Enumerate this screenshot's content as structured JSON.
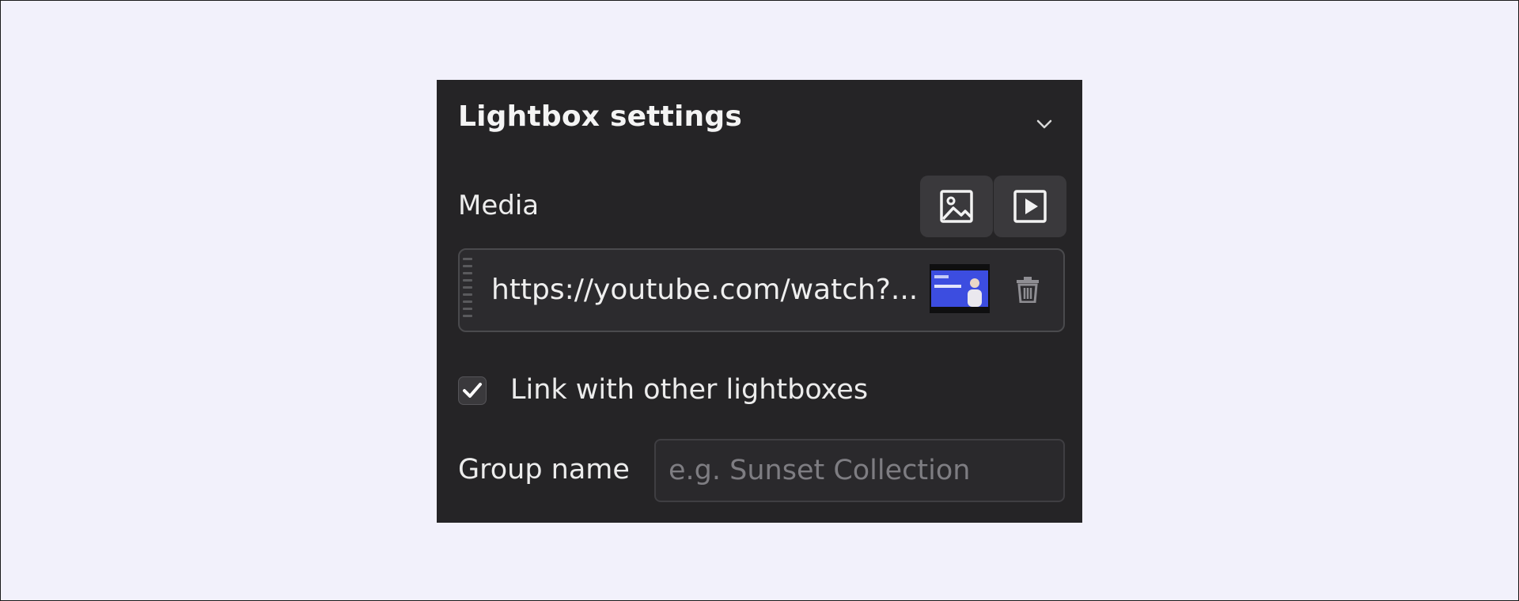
{
  "panel": {
    "title": "Lightbox settings",
    "collapse_icon": "chevron-down-icon"
  },
  "media": {
    "label": "Media",
    "buttons": [
      {
        "name": "image-media-button",
        "icon": "image-icon",
        "selected": false
      },
      {
        "name": "video-media-button",
        "icon": "play-square-icon",
        "selected": true
      }
    ],
    "item": {
      "url": "https://youtube.com/watch?...",
      "thumbnail_icon": "video-thumbnail",
      "delete_icon": "trash-icon",
      "handle_icon": "drag-handle-icon"
    }
  },
  "link": {
    "checked": true,
    "label": "Link with other lightboxes"
  },
  "group": {
    "label": "Group name",
    "placeholder": "e.g. Sunset Collection",
    "value": ""
  },
  "colors": {
    "panel_bg": "#252426",
    "page_bg": "#f2f1fb",
    "button_bg": "#3a393c",
    "text": "#f2f2f2",
    "placeholder": "#7e7d82",
    "thumbnail_blue": "#3c4de0"
  }
}
